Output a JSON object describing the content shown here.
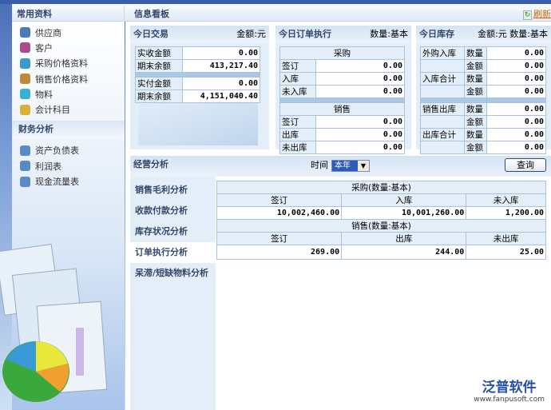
{
  "header": {
    "left_title": "常用资料",
    "right_title": "信息看板",
    "refresh": "刷新"
  },
  "sidebar": {
    "common": [
      "供应商",
      "客户",
      "采购价格资料",
      "销售价格资料",
      "物料",
      "会计科目"
    ],
    "finance_title": "财务分析",
    "finance": [
      "资产负债表",
      "利润表",
      "现金流量表"
    ]
  },
  "today_trade": {
    "title": "今日交易",
    "unit": "金额:元",
    "rows": [
      [
        "实收金额",
        "0.00"
      ],
      [
        "期末余额",
        "413,217.40"
      ],
      [
        "实付金额",
        "0.00"
      ],
      [
        "期末余额",
        "4,151,040.40"
      ]
    ]
  },
  "today_order": {
    "title": "今日订单执行",
    "unit": "数量:基本",
    "purchase": "采购",
    "sales": "销售",
    "purchase_rows": [
      [
        "签订",
        "0.00"
      ],
      [
        "入库",
        "0.00"
      ],
      [
        "未入库",
        "0.00"
      ]
    ],
    "sales_rows": [
      [
        "签订",
        "0.00"
      ],
      [
        "出库",
        "0.00"
      ],
      [
        "未出库",
        "0.00"
      ]
    ]
  },
  "today_stock": {
    "title": "今日库存",
    "unit": "金额:元 数量:基本",
    "rows": [
      [
        "外购入库",
        "数量",
        "0.00"
      ],
      [
        "",
        "金额",
        "0.00"
      ],
      [
        "入库合计",
        "数量",
        "0.00"
      ],
      [
        "",
        "金额",
        "0.00"
      ],
      [
        "销售出库",
        "数量",
        "0.00"
      ],
      [
        "",
        "金额",
        "0.00"
      ],
      [
        "出库合计",
        "数量",
        "0.00"
      ],
      [
        "",
        "金额",
        "0.00"
      ]
    ]
  },
  "analysis": {
    "title": "经营分析",
    "time_label": "时间",
    "time_value": "本年",
    "query": "查询",
    "tabs": [
      "销售毛利分析",
      "收款付款分析",
      "库存状况分析",
      "订单执行分析",
      "呆滞/短缺物料分析"
    ],
    "purchase_title": "采购(数量:基本)",
    "purchase_cols": [
      "签订",
      "入库",
      "未入库"
    ],
    "purchase_vals": [
      "10,002,460.00",
      "10,001,260.00",
      "1,200.00"
    ],
    "sales_title": "销售(数量:基本)",
    "sales_cols": [
      "签订",
      "出库",
      "未出库"
    ],
    "sales_vals": [
      "269.00",
      "244.00",
      "25.00"
    ]
  },
  "logo": {
    "name": "泛普软件",
    "url": "www.fanpusoft.com"
  }
}
